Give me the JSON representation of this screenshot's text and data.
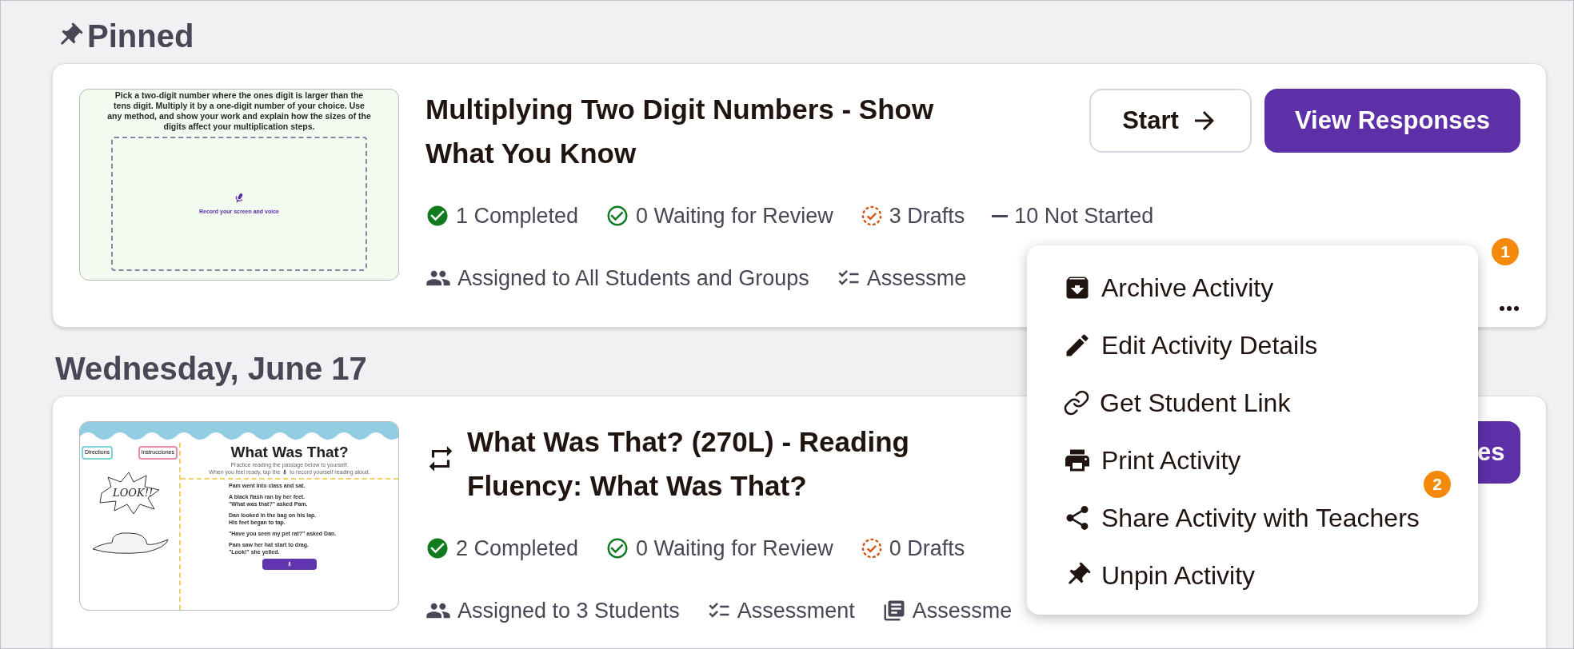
{
  "sections": [
    {
      "heading": "Pinned",
      "pinned": true,
      "cards": [
        {
          "title": "Multiplying Two Digit Numbers - Show What You Know",
          "recurring": false,
          "more_button": true,
          "thumbnail": {
            "kind": "prompt",
            "prompt": "Pick a two-digit number where the ones digit is larger than the tens digit. Multiply it by a one-digit number of your choice. Use any method, and show your work and explain how the sizes of the digits affect your multiplication steps.",
            "record_label": "Record your screen and voice"
          },
          "actions": [
            {
              "kind": "start",
              "label": "Start"
            },
            {
              "kind": "primary",
              "label": "View Responses"
            }
          ],
          "statuses": [
            {
              "kind": "completed",
              "label": "1 Completed"
            },
            {
              "kind": "waiting",
              "label": "0 Waiting for Review"
            },
            {
              "kind": "draft",
              "label": "3 Drafts"
            },
            {
              "kind": "not_started",
              "label": "10 Not Started"
            }
          ],
          "meta": [
            {
              "kind": "assigned",
              "label": "Assigned to All Students and Groups"
            },
            {
              "kind": "assessment",
              "label": "Assessme"
            }
          ]
        }
      ]
    },
    {
      "heading": "Wednesday, June 17",
      "pinned": false,
      "cards": [
        {
          "title": "What Was That? (270L) - Reading Fluency: What Was That?",
          "recurring": true,
          "more_button": false,
          "thumbnail": {
            "kind": "reading",
            "tabs": [
              "Directions",
              "Instrucciones"
            ],
            "sound_word": "LOOK!!",
            "title": "What Was That?",
            "instruction": "Practice reading the passage below to yourself.",
            "tap_before": "When you feel ready, tap the",
            "tap_after": "to record yourself reading aloud.",
            "passage": [
              [
                "Pam went into class and sat."
              ],
              [
                "A black flash ran by her feet.",
                "\"What was that?\" asked Pam."
              ],
              [
                "Dan looked in the bag on his lap.",
                "His feet began to tap."
              ],
              [
                "\"Have you seen my pet rat?\" asked Dan."
              ],
              [
                "Pam saw her hat start to drag.",
                "\"Look!\" she yelled."
              ]
            ]
          },
          "actions": [
            {
              "kind": "primary_partial",
              "label": "es"
            }
          ],
          "statuses": [
            {
              "kind": "completed",
              "label": "2 Completed"
            },
            {
              "kind": "waiting",
              "label": "0 Waiting for Review"
            },
            {
              "kind": "draft",
              "label": "0 Drafts"
            }
          ],
          "meta": [
            {
              "kind": "assigned",
              "label": "Assigned to 3 Students"
            },
            {
              "kind": "assessment",
              "label": "Assessment"
            },
            {
              "kind": "resource",
              "label": "Assessme"
            }
          ]
        }
      ]
    }
  ],
  "menu": {
    "items": [
      {
        "kind": "archive",
        "label": "Archive Activity"
      },
      {
        "kind": "edit",
        "label": "Edit Activity Details"
      },
      {
        "kind": "link",
        "label": "Get Student Link"
      },
      {
        "kind": "print",
        "label": "Print Activity"
      },
      {
        "kind": "share",
        "label": "Share Activity with Teachers"
      },
      {
        "kind": "unpin",
        "label": "Unpin Activity"
      }
    ]
  },
  "markers": [
    {
      "label": "1"
    },
    {
      "label": "2"
    }
  ]
}
